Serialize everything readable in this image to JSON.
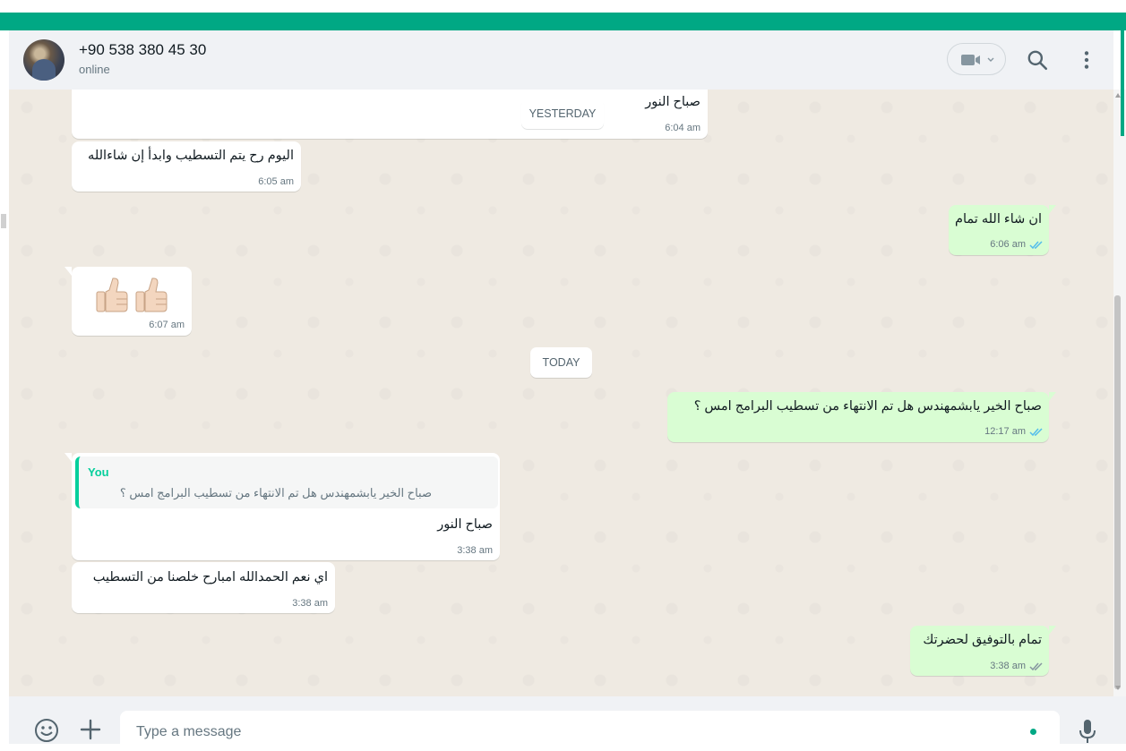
{
  "header": {
    "contact_name": "+90 538 380 45 30",
    "status": "online",
    "icons": [
      "video-call-icon",
      "chevron-down-icon",
      "search-icon",
      "menu-dots-icon"
    ]
  },
  "dates": {
    "yesterday": "YESTERDAY",
    "today": "TODAY"
  },
  "messages": [
    {
      "direction": "in",
      "text": "صباح النور",
      "time": "6:04 am"
    },
    {
      "direction": "in",
      "text": "اليوم رح يتم التسطيب وابدأ إن شاءالله",
      "time": "6:05 am"
    },
    {
      "direction": "out",
      "text": "ان شاء الله تمام",
      "time": "6:06 am",
      "status": "read"
    },
    {
      "direction": "in",
      "text": "👍🏻👍🏻",
      "time": "6:07 am"
    },
    {
      "direction": "out",
      "text": "صباح الخير يابشمهندس هل تم الانتهاء من تسطيب البرامج امس ؟",
      "time": "12:17 am",
      "status": "read"
    },
    {
      "direction": "in",
      "quote_author": "You",
      "quote_text": "صباح الخير يابشمهندس هل تم الانتهاء من تسطيب البرامج امس ؟",
      "text": "صباح النور",
      "time": "3:38 am"
    },
    {
      "direction": "in",
      "text": "اي نعم الحمدالله امبارح خلصنا من التسطيب",
      "time": "3:38 am"
    },
    {
      "direction": "out",
      "text": "تمام بالتوفيق لحضرتك",
      "time": "3:38 am",
      "status": "delivered"
    }
  ],
  "composer": {
    "placeholder": "Type a message",
    "icons": [
      "emoji-icon",
      "attach-plus-icon",
      "microphone-icon"
    ]
  },
  "colors": {
    "brand": "#00a884",
    "outgoing_bubble": "#d9fdd3",
    "incoming_bubble": "#ffffff",
    "chat_background": "#efeae2",
    "read_ticks": "#53bdeb",
    "delivered_ticks": "#8696a0"
  }
}
